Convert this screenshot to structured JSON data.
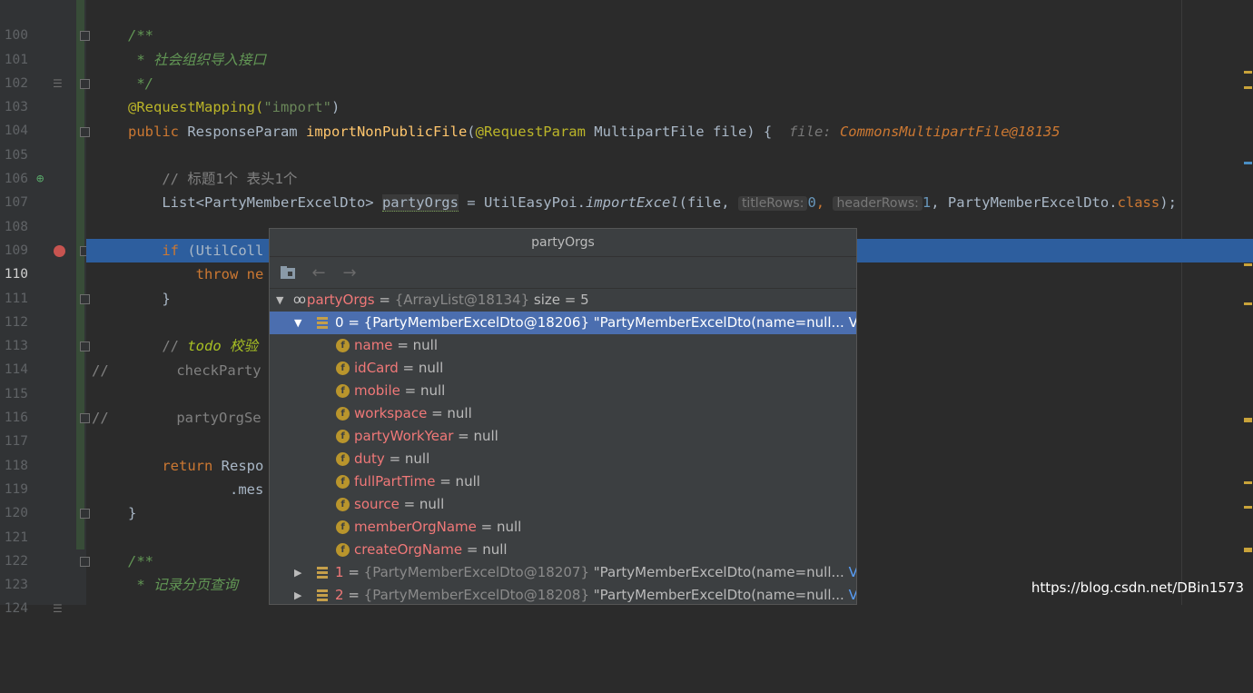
{
  "editor": {
    "lines": [
      {
        "num": "100"
      },
      {
        "num": "101"
      },
      {
        "num": "102"
      },
      {
        "num": "103"
      },
      {
        "num": "104"
      },
      {
        "num": "105"
      },
      {
        "num": "106"
      },
      {
        "num": "107"
      },
      {
        "num": "108"
      },
      {
        "num": "109"
      },
      {
        "num": "110"
      },
      {
        "num": "111"
      },
      {
        "num": "112"
      },
      {
        "num": "113"
      },
      {
        "num": "114"
      },
      {
        "num": "115"
      },
      {
        "num": "116"
      },
      {
        "num": "117"
      },
      {
        "num": "118"
      },
      {
        "num": "119"
      },
      {
        "num": "120"
      },
      {
        "num": "121"
      },
      {
        "num": "122"
      },
      {
        "num": "123"
      },
      {
        "num": "124"
      }
    ],
    "code": {
      "l101": "/**",
      "l102": " * 社会组织导入接口",
      "l103": " */",
      "l104_an": "@RequestMapping(",
      "l104_str": "\"import\"",
      "l104_end": ")",
      "l105_kw": "public ",
      "l105_type": "ResponseParam ",
      "l105_fn": "importNonPublicFile",
      "l105_p1": "(",
      "l105_an": "@RequestParam",
      "l105_p2": " MultipartFile file) {",
      "l105_inline_key": "file: ",
      "l105_inline_val": "CommonsMultipartFile@18135",
      "l107": "// 标题1个 表头1个",
      "l108_a": "List<PartyMemberExcelDto> ",
      "l108_var": "partyOrgs",
      "l108_b": " = UtilEasyPoi.",
      "l108_fn": "importExcel",
      "l108_c": "(file, ",
      "l108_h1": "titleRows:",
      "l108_v1": "0",
      "l108_comma1": ", ",
      "l108_h2": "headerRows:",
      "l108_v2": "1",
      "l108_d": ", PartyMemberExcelDto.",
      "l108_kw": "class",
      "l108_e": ");",
      "l110_kw": "if ",
      "l110_rest": "(UtilColl",
      "l111_kw": "throw ",
      "l111_rest": "ne",
      "l112": "}",
      "l114_c": "// ",
      "l114_todo": "todo 校验",
      "l115_c": "//",
      "l115_rest": "        checkParty",
      "l117_c": "//",
      "l117_rest": "        partyOrgSe",
      "l119_kw": "return ",
      "l119_rest": "Respo",
      "l120": ".mes",
      "l121": "}",
      "l123": "/**",
      "l124": " * 记录分页查询"
    }
  },
  "popup": {
    "title": "partyOrgs",
    "root": {
      "name": "partyOrgs",
      "eq": " = ",
      "type": "{ArrayList@18134}",
      "size": "  size = 5"
    },
    "item0": {
      "index": "0",
      "eq": " = ",
      "type": "{PartyMemberExcelDto@18206}",
      "text": " \"PartyMemberExcelDto(name=null...",
      "view": " View"
    },
    "fields": [
      {
        "name": "name",
        "value": " = null"
      },
      {
        "name": "idCard",
        "value": " = null"
      },
      {
        "name": "mobile",
        "value": " = null"
      },
      {
        "name": "workspace",
        "value": " = null"
      },
      {
        "name": "partyWorkYear",
        "value": " = null"
      },
      {
        "name": "duty",
        "value": " = null"
      },
      {
        "name": "fullPartTime",
        "value": " = null"
      },
      {
        "name": "source",
        "value": " = null"
      },
      {
        "name": "memberOrgName",
        "value": " = null"
      },
      {
        "name": "createOrgName",
        "value": " = null"
      }
    ],
    "item1": {
      "index": "1",
      "eq": " = ",
      "type": "{PartyMemberExcelDto@18207}",
      "text": " \"PartyMemberExcelDto(name=null...",
      "view": " View"
    },
    "item2": {
      "index": "2",
      "eq": " = ",
      "type": "{PartyMemberExcelDto@18208}",
      "text": " \"PartyMemberExcelDto(name=null...",
      "view": " View"
    },
    "field_icon_letter": "f"
  },
  "watermark": "https://blog.csdn.net/DBin1573",
  "colors": {
    "selection": "#2d5e9e",
    "tree_selection": "#4b6eaf",
    "keyword": "#cc7832",
    "field": "#f07878"
  }
}
